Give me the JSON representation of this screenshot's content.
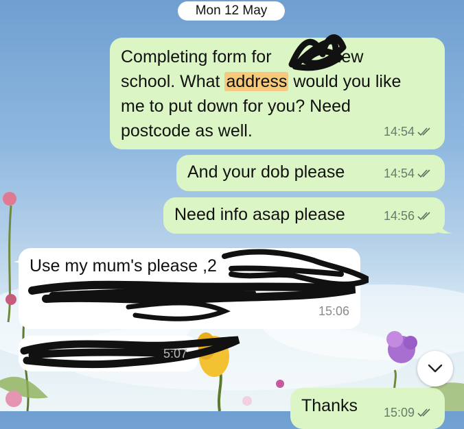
{
  "date_divider": "Mon 12 May",
  "messages": [
    {
      "text_lines": [
        "Completing form for",
        "new",
        "school. What ",
        "address",
        " would you like",
        "me to put down for you? Need",
        "postcode as well."
      ],
      "time": "14:54"
    },
    {
      "text": "And your dob please",
      "time": "14:54"
    },
    {
      "text": "Need info asap please",
      "time": "14:56"
    },
    {
      "text": "Use my mum's please ,2",
      "time": "15:06"
    },
    {
      "time_partial": "5:07"
    },
    {
      "text": "Thanks",
      "time_partial": "15:09"
    }
  ],
  "colors": {
    "outgoing_bubble": "#dbf5c4",
    "incoming_bubble": "#ffffff",
    "highlight": "#f7c97a",
    "read_ticks": "#6b7a6b"
  },
  "icons": {
    "read_receipt": "double-check-icon",
    "scroll_down": "chevron-down-icon"
  }
}
